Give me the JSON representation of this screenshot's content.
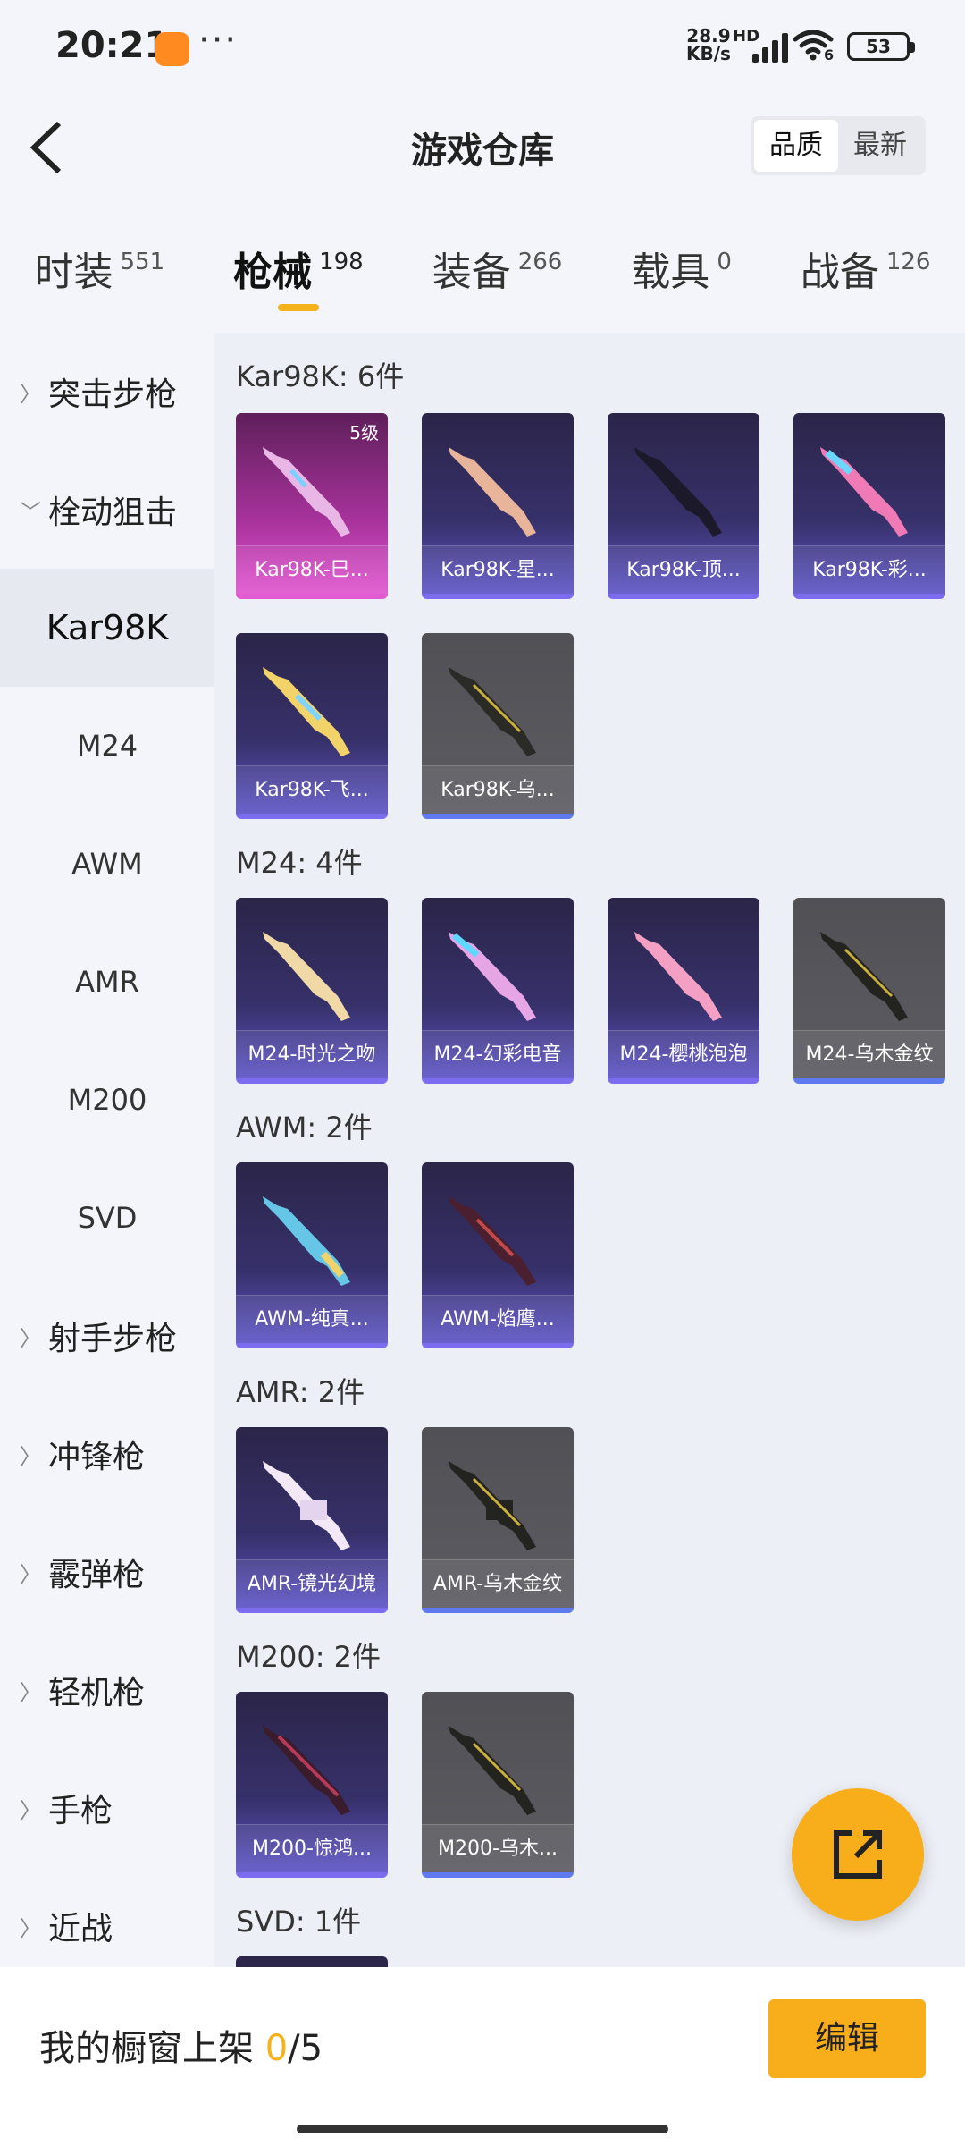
{
  "status": {
    "time": "20:21",
    "speed_value": "28.9",
    "speed_unit": "KB/s",
    "signal_label": "HD",
    "wifi_label": "6",
    "battery": "53"
  },
  "header": {
    "title": "游戏仓库",
    "sort_options": [
      "品质",
      "最新"
    ]
  },
  "tabs": [
    {
      "label": "时装",
      "count": "551"
    },
    {
      "label": "枪械",
      "count": "198"
    },
    {
      "label": "装备",
      "count": "266"
    },
    {
      "label": "载具",
      "count": "0"
    },
    {
      "label": "战备",
      "count": "126"
    }
  ],
  "sidebar": {
    "items": [
      {
        "label": "突击步枪"
      },
      {
        "label": "栓动狙击"
      },
      {
        "label": "Kar98K"
      },
      {
        "label": "M24"
      },
      {
        "label": "AWM"
      },
      {
        "label": "AMR"
      },
      {
        "label": "M200"
      },
      {
        "label": "SVD"
      },
      {
        "label": "射手步枪"
      },
      {
        "label": "冲锋枪"
      },
      {
        "label": "霰弹枪"
      },
      {
        "label": "轻机枪"
      },
      {
        "label": "手枪"
      },
      {
        "label": "近战"
      }
    ]
  },
  "sections": [
    {
      "title": "Kar98K: 6件",
      "items": [
        {
          "name": "Kar98K-巳...",
          "badge": "5级"
        },
        {
          "name": "Kar98K-星..."
        },
        {
          "name": "Kar98K-顶..."
        },
        {
          "name": "Kar98K-彩..."
        },
        {
          "name": "Kar98K-飞..."
        },
        {
          "name": "Kar98K-乌..."
        }
      ]
    },
    {
      "title": "M24: 4件",
      "items": [
        {
          "name": "M24-时光之吻"
        },
        {
          "name": "M24-幻彩电音"
        },
        {
          "name": "M24-樱桃泡泡"
        },
        {
          "name": "M24-乌木金纹"
        }
      ]
    },
    {
      "title": "AWM: 2件",
      "items": [
        {
          "name": "AWM-纯真..."
        },
        {
          "name": "AWM-焰鹰..."
        }
      ]
    },
    {
      "title": "AMR: 2件",
      "items": [
        {
          "name": "AMR-镜光幻境"
        },
        {
          "name": "AMR-乌木金纹"
        }
      ]
    },
    {
      "title": "M200: 2件",
      "items": [
        {
          "name": "M200-惊鸿..."
        },
        {
          "name": "M200-乌木..."
        }
      ]
    },
    {
      "title": "SVD: 1件",
      "items": []
    }
  ],
  "bottom": {
    "label_prefix": "我的橱窗上架 ",
    "count_current": "0",
    "count_total": "/5",
    "edit_label": "编辑"
  },
  "colors": {
    "accent": "#f8ad1a",
    "card_purple": "#5e55c6",
    "card_pink": "#e055cf",
    "card_gray": "#5c5c62"
  }
}
